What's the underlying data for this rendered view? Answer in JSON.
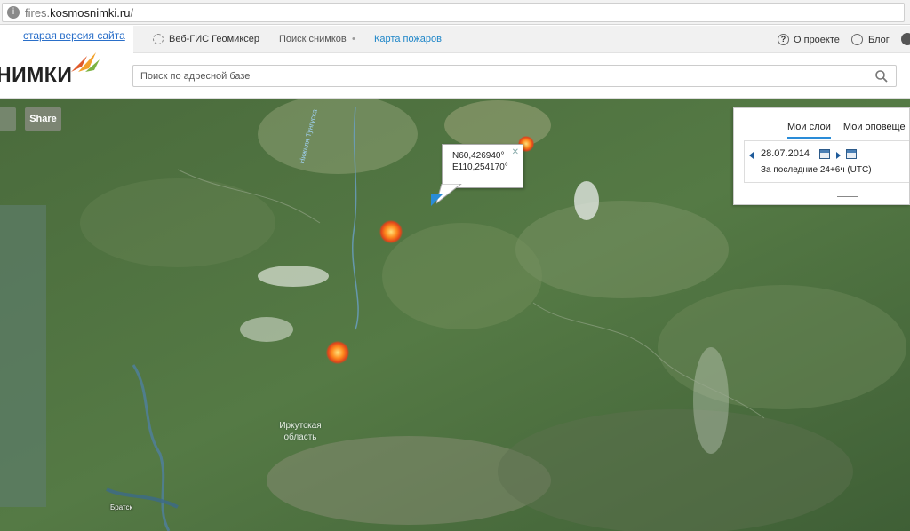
{
  "browser": {
    "url_host": "fires.",
    "url_domain": "kosmosnimki.ru",
    "url_path": "/"
  },
  "header": {
    "old_version_link": "старая версия сайта",
    "nav": [
      {
        "label": "Веб-ГИС Геомиксер"
      },
      {
        "label": "Поиск снимков"
      },
      {
        "label": "Карта пожаров"
      }
    ],
    "about_label": "О проекте",
    "blog_label": "Блог",
    "logo_text": "НИМКИ",
    "search_placeholder": "Поиск по адресной базе"
  },
  "map": {
    "share_label": "Share",
    "popup": {
      "lat": "N60,426940°",
      "lon": "E110,254170°"
    },
    "region_label": "Иркутская область",
    "river_label": "Нижняя Тунгуска",
    "city_label": "Братск"
  },
  "layers_panel": {
    "tabs": [
      "Мои слои",
      "Мои оповеще"
    ],
    "date": "28.07.2014",
    "period": "За последние 24+6ч (UTC)"
  },
  "colors": {
    "accent": "#1f86c8",
    "link": "#2a6fc9",
    "fire": "#ff8a1e"
  }
}
